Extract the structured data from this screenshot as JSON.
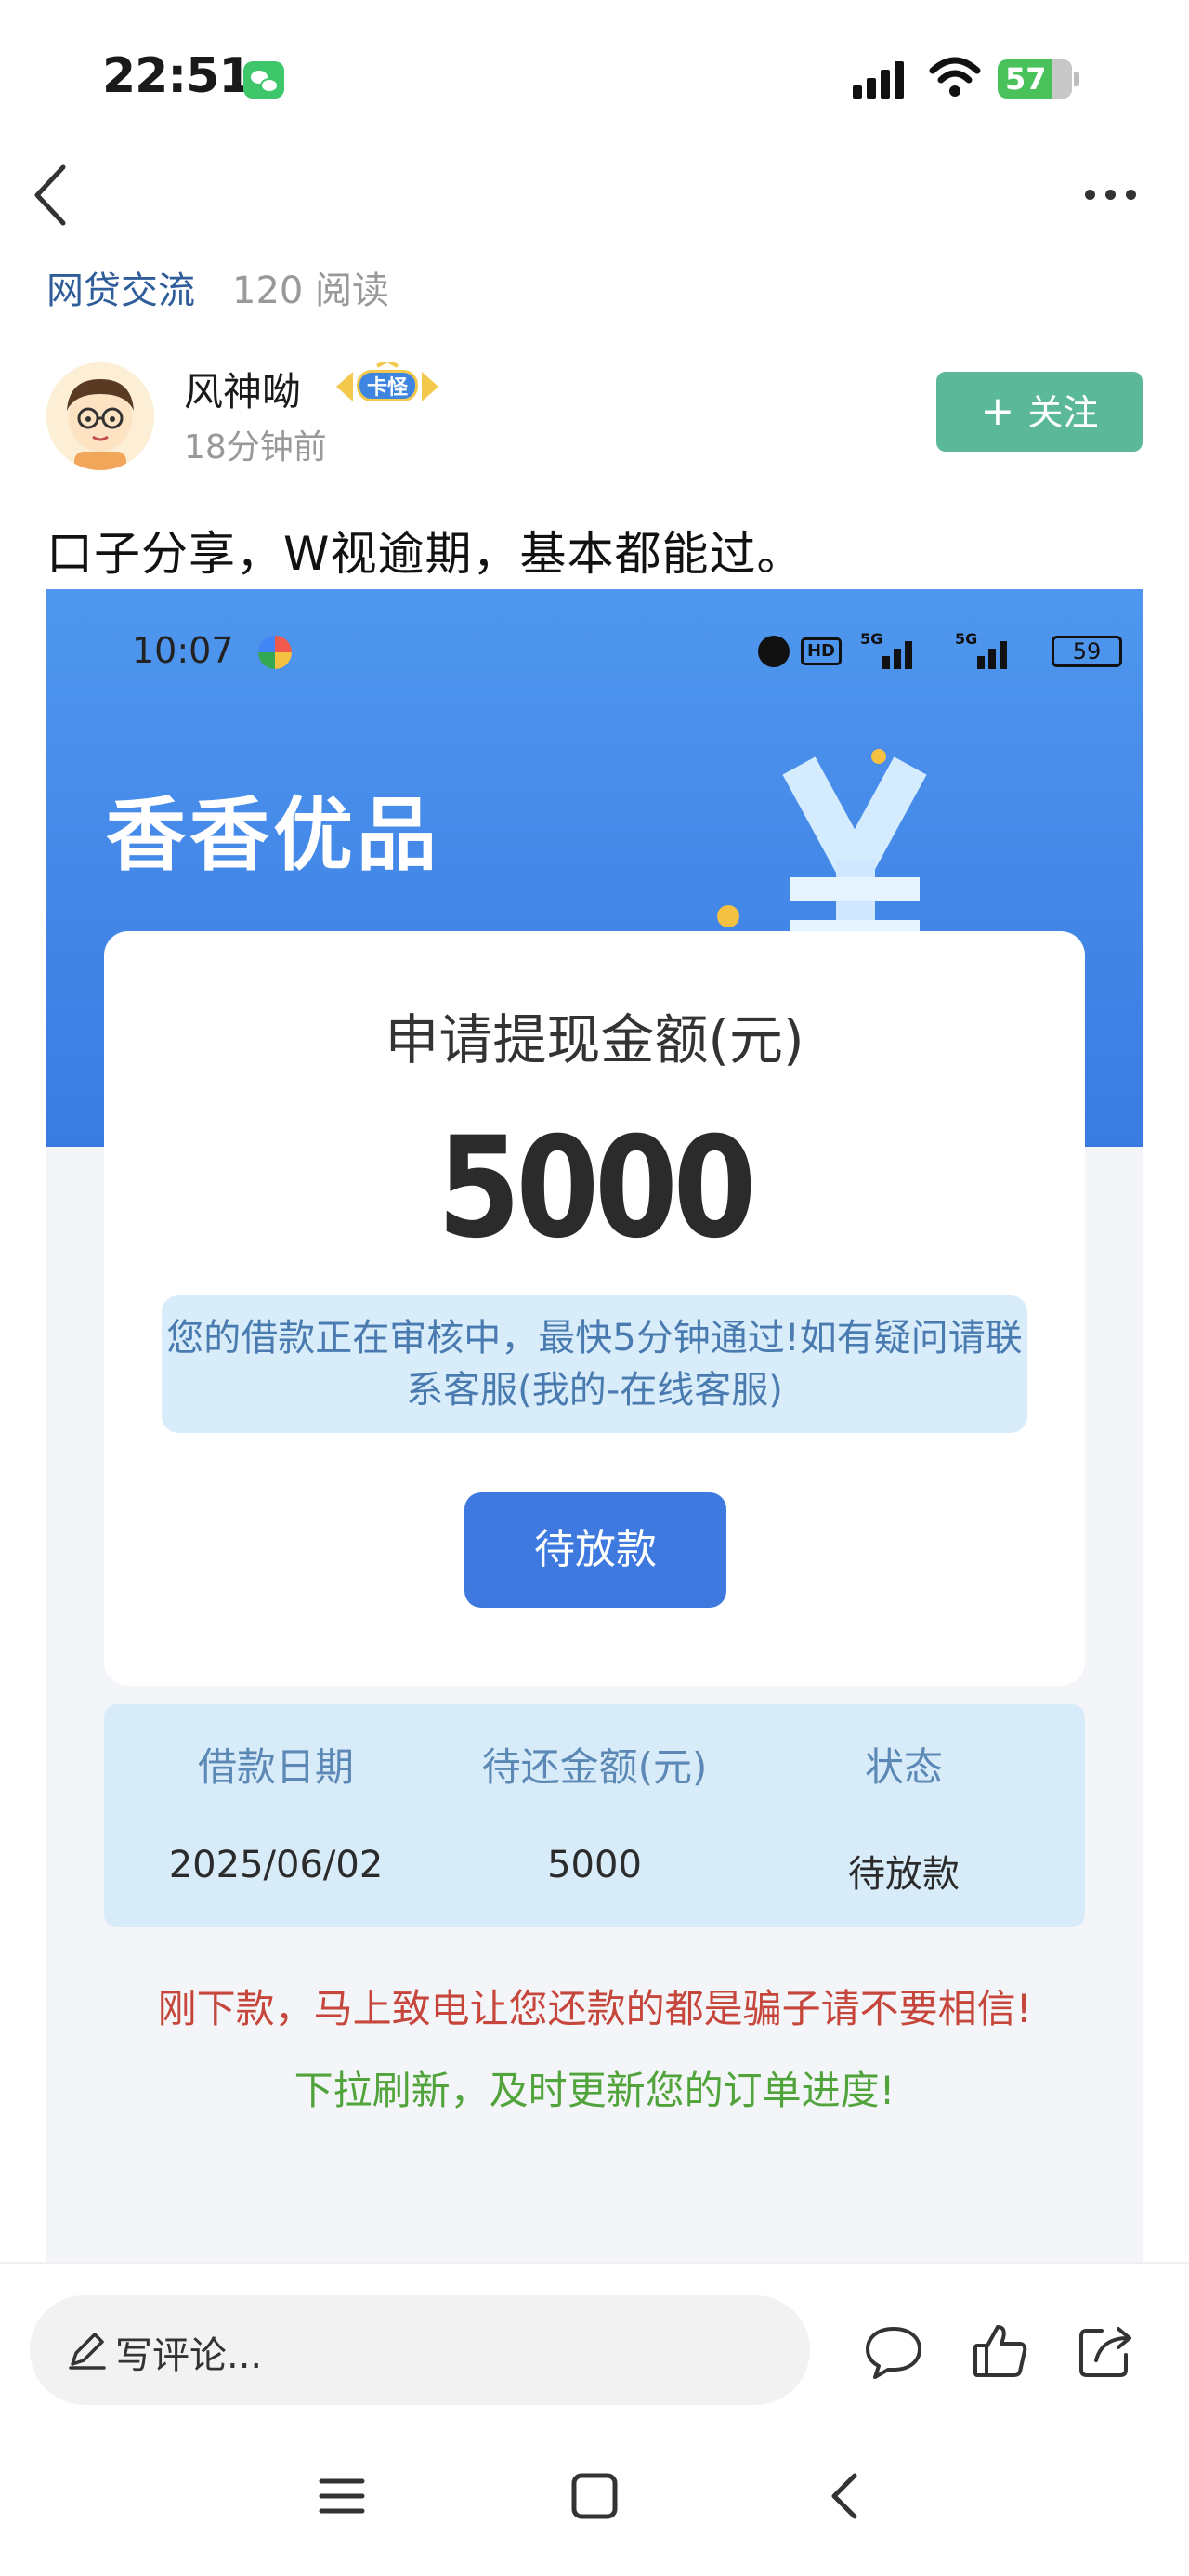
{
  "status_bar": {
    "time": "22:51",
    "battery": "57",
    "icons": [
      "wechat-icon",
      "signal-icon",
      "wifi-icon",
      "battery-icon"
    ]
  },
  "nav": {
    "back_icon": "back-chevron-icon",
    "more_icon": "more-dots-icon"
  },
  "post": {
    "topic": "网贷交流",
    "reads": "120 阅读",
    "author": "风神呦",
    "badge": "卡怪",
    "time": "18分钟前",
    "follow_label": "关注",
    "follow_color": "#5bb99a",
    "text": "口子分享，W视逾期，基本都能过。"
  },
  "screenshot": {
    "time": "10:07",
    "hd_label": "HD",
    "signal1_label": "5G",
    "signal2_label": "5G",
    "battery": "59",
    "brand": "香香优品",
    "card": {
      "title": "申请提现金额(元)",
      "amount": "5000",
      "notice": "您的借款正在审核中，最快5分钟通过!如有疑问请联系客服(我的-在线客服)",
      "button_label": "待放款"
    },
    "table": {
      "headers": [
        "借款日期",
        "待还金额(元)",
        "状态"
      ],
      "values": [
        "2025/06/02",
        "5000",
        "待放款"
      ]
    },
    "warning_red": "刚下款，马上致电让您还款的都是骗子请不要相信!",
    "warning_green": "下拉刷新，及时更新您的订单进度!",
    "colors": {
      "hero": "#4f97ee",
      "button": "#3d79df",
      "red": "#c6463c",
      "green": "#51a33c"
    }
  },
  "bottom_bar": {
    "comment_placeholder": "写评论...",
    "actions": [
      "comment-icon",
      "like-icon",
      "share-icon"
    ]
  },
  "system_nav": [
    "menu-icon",
    "home-icon",
    "back-icon"
  ]
}
